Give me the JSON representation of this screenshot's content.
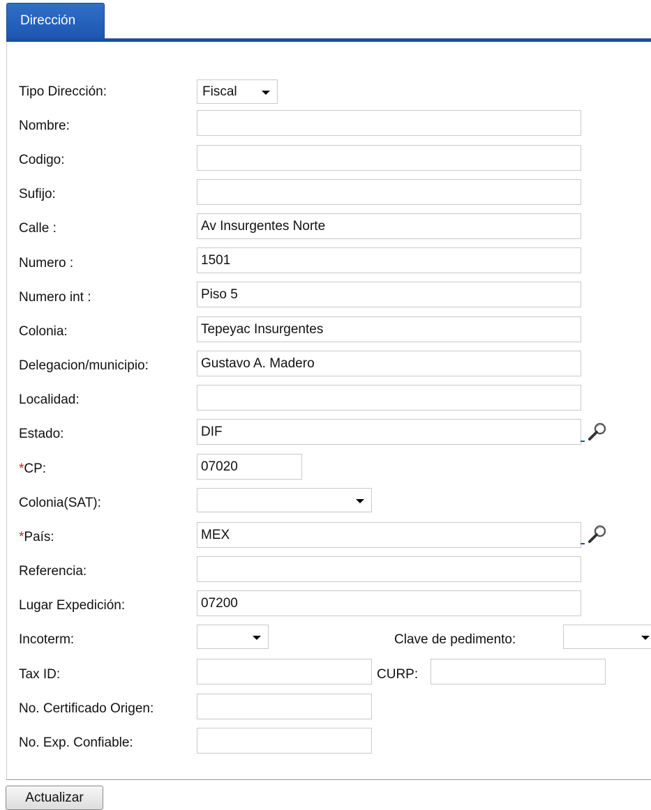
{
  "tab": {
    "title": "Dirección"
  },
  "form": {
    "tipo_direccion": {
      "label": "Tipo Dirección:",
      "value": "Fiscal"
    },
    "nombre": {
      "label": "Nombre:",
      "value": ""
    },
    "codigo": {
      "label": "Codigo:",
      "value": ""
    },
    "sufijo": {
      "label": "Sufijo:",
      "value": ""
    },
    "calle": {
      "label": "Calle :",
      "value": "Av Insurgentes Norte"
    },
    "numero": {
      "label": "Numero :",
      "value": "1501"
    },
    "numero_int": {
      "label": "Numero int :",
      "value": "Piso 5"
    },
    "colonia": {
      "label": "Colonia:",
      "value": "Tepeyac Insurgentes"
    },
    "delegacion": {
      "label": "Delegacion/municipio:",
      "value": "Gustavo A. Madero"
    },
    "localidad": {
      "label": "Localidad:",
      "value": ""
    },
    "estado": {
      "label": "Estado:",
      "value": "DIF"
    },
    "cp": {
      "required_mark": "*",
      "label": "CP:",
      "value": "07020"
    },
    "colonia_sat": {
      "label": "Colonia(SAT):",
      "value": ""
    },
    "pais": {
      "required_mark": "*",
      "label": "País:",
      "value": "MEX"
    },
    "referencia": {
      "label": "Referencia:",
      "value": ""
    },
    "lugar_expedicion": {
      "label": "Lugar Expedición:",
      "value": "07200"
    },
    "incoterm": {
      "label": "Incoterm:",
      "value": ""
    },
    "clave_pedimento": {
      "label": "Clave de pedimento:",
      "value": ""
    },
    "tax_id": {
      "label": "Tax ID:",
      "value": ""
    },
    "curp": {
      "label": "CURP:",
      "value": ""
    },
    "certificado_origen": {
      "label": "No. Certificado Origen:",
      "value": ""
    },
    "exp_confiable": {
      "label": "No. Exp. Confiable:",
      "value": ""
    }
  },
  "actions": {
    "update_label": "Actualizar"
  },
  "icons": {
    "lookup": "magnifier-icon",
    "dropdown": "chevron-down-icon"
  },
  "colors": {
    "tab": "#1d56b0",
    "required": "#cc1f1f"
  }
}
